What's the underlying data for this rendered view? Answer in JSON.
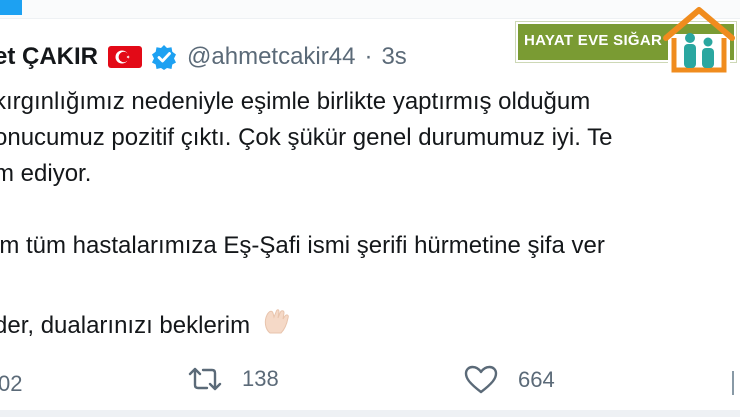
{
  "author": {
    "name": "et ÇAKIR",
    "handle": "@ahmetcakir44",
    "separator": "·",
    "time": "3s"
  },
  "tweet": {
    "line1": "kırgınlığımız nedeniyle eşimle birlikte yaptırmış olduğum",
    "line2": "onucumuz pozitif çıktı. Çok şükür genel durumumuz iyi. Te",
    "line3": "m ediyor.",
    "line4": "im tüm hastalarımıza Eş-Şafi ismi şerifi hürmetine şifa ver",
    "line5": "der, dualarınızı beklerim"
  },
  "badge": {
    "text": "HAYAT EVE SIĞAR",
    "colors": {
      "background": "#7a9b33",
      "house_orange": "#f08c1e",
      "house_teal": "#2aa7a0"
    }
  },
  "actions": {
    "reply_count": "02",
    "retweet_count": "138",
    "like_count": "664"
  },
  "colors": {
    "text": "#14171a",
    "secondary": "#5b6a78",
    "verified": "#1da1f2",
    "flag_red": "#e30a17"
  },
  "icons": [
    "turkey-flag-icon",
    "verified-icon",
    "praying-hands-icon",
    "retweet-icon",
    "heart-icon",
    "house-family-icon"
  ]
}
